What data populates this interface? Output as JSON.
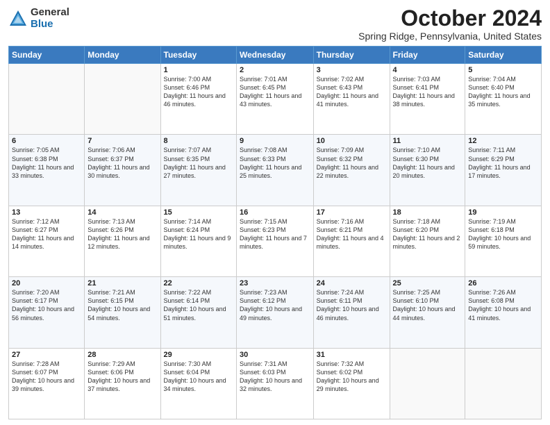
{
  "header": {
    "logo": {
      "general": "General",
      "blue": "Blue"
    },
    "title": "October 2024",
    "location": "Spring Ridge, Pennsylvania, United States"
  },
  "calendar": {
    "headers": [
      "Sunday",
      "Monday",
      "Tuesday",
      "Wednesday",
      "Thursday",
      "Friday",
      "Saturday"
    ],
    "rows": [
      [
        {
          "day": "",
          "info": ""
        },
        {
          "day": "",
          "info": ""
        },
        {
          "day": "1",
          "info": "Sunrise: 7:00 AM\nSunset: 6:46 PM\nDaylight: 11 hours and 46 minutes."
        },
        {
          "day": "2",
          "info": "Sunrise: 7:01 AM\nSunset: 6:45 PM\nDaylight: 11 hours and 43 minutes."
        },
        {
          "day": "3",
          "info": "Sunrise: 7:02 AM\nSunset: 6:43 PM\nDaylight: 11 hours and 41 minutes."
        },
        {
          "day": "4",
          "info": "Sunrise: 7:03 AM\nSunset: 6:41 PM\nDaylight: 11 hours and 38 minutes."
        },
        {
          "day": "5",
          "info": "Sunrise: 7:04 AM\nSunset: 6:40 PM\nDaylight: 11 hours and 35 minutes."
        }
      ],
      [
        {
          "day": "6",
          "info": "Sunrise: 7:05 AM\nSunset: 6:38 PM\nDaylight: 11 hours and 33 minutes."
        },
        {
          "day": "7",
          "info": "Sunrise: 7:06 AM\nSunset: 6:37 PM\nDaylight: 11 hours and 30 minutes."
        },
        {
          "day": "8",
          "info": "Sunrise: 7:07 AM\nSunset: 6:35 PM\nDaylight: 11 hours and 27 minutes."
        },
        {
          "day": "9",
          "info": "Sunrise: 7:08 AM\nSunset: 6:33 PM\nDaylight: 11 hours and 25 minutes."
        },
        {
          "day": "10",
          "info": "Sunrise: 7:09 AM\nSunset: 6:32 PM\nDaylight: 11 hours and 22 minutes."
        },
        {
          "day": "11",
          "info": "Sunrise: 7:10 AM\nSunset: 6:30 PM\nDaylight: 11 hours and 20 minutes."
        },
        {
          "day": "12",
          "info": "Sunrise: 7:11 AM\nSunset: 6:29 PM\nDaylight: 11 hours and 17 minutes."
        }
      ],
      [
        {
          "day": "13",
          "info": "Sunrise: 7:12 AM\nSunset: 6:27 PM\nDaylight: 11 hours and 14 minutes."
        },
        {
          "day": "14",
          "info": "Sunrise: 7:13 AM\nSunset: 6:26 PM\nDaylight: 11 hours and 12 minutes."
        },
        {
          "day": "15",
          "info": "Sunrise: 7:14 AM\nSunset: 6:24 PM\nDaylight: 11 hours and 9 minutes."
        },
        {
          "day": "16",
          "info": "Sunrise: 7:15 AM\nSunset: 6:23 PM\nDaylight: 11 hours and 7 minutes."
        },
        {
          "day": "17",
          "info": "Sunrise: 7:16 AM\nSunset: 6:21 PM\nDaylight: 11 hours and 4 minutes."
        },
        {
          "day": "18",
          "info": "Sunrise: 7:18 AM\nSunset: 6:20 PM\nDaylight: 11 hours and 2 minutes."
        },
        {
          "day": "19",
          "info": "Sunrise: 7:19 AM\nSunset: 6:18 PM\nDaylight: 10 hours and 59 minutes."
        }
      ],
      [
        {
          "day": "20",
          "info": "Sunrise: 7:20 AM\nSunset: 6:17 PM\nDaylight: 10 hours and 56 minutes."
        },
        {
          "day": "21",
          "info": "Sunrise: 7:21 AM\nSunset: 6:15 PM\nDaylight: 10 hours and 54 minutes."
        },
        {
          "day": "22",
          "info": "Sunrise: 7:22 AM\nSunset: 6:14 PM\nDaylight: 10 hours and 51 minutes."
        },
        {
          "day": "23",
          "info": "Sunrise: 7:23 AM\nSunset: 6:12 PM\nDaylight: 10 hours and 49 minutes."
        },
        {
          "day": "24",
          "info": "Sunrise: 7:24 AM\nSunset: 6:11 PM\nDaylight: 10 hours and 46 minutes."
        },
        {
          "day": "25",
          "info": "Sunrise: 7:25 AM\nSunset: 6:10 PM\nDaylight: 10 hours and 44 minutes."
        },
        {
          "day": "26",
          "info": "Sunrise: 7:26 AM\nSunset: 6:08 PM\nDaylight: 10 hours and 41 minutes."
        }
      ],
      [
        {
          "day": "27",
          "info": "Sunrise: 7:28 AM\nSunset: 6:07 PM\nDaylight: 10 hours and 39 minutes."
        },
        {
          "day": "28",
          "info": "Sunrise: 7:29 AM\nSunset: 6:06 PM\nDaylight: 10 hours and 37 minutes."
        },
        {
          "day": "29",
          "info": "Sunrise: 7:30 AM\nSunset: 6:04 PM\nDaylight: 10 hours and 34 minutes."
        },
        {
          "day": "30",
          "info": "Sunrise: 7:31 AM\nSunset: 6:03 PM\nDaylight: 10 hours and 32 minutes."
        },
        {
          "day": "31",
          "info": "Sunrise: 7:32 AM\nSunset: 6:02 PM\nDaylight: 10 hours and 29 minutes."
        },
        {
          "day": "",
          "info": ""
        },
        {
          "day": "",
          "info": ""
        }
      ]
    ]
  }
}
